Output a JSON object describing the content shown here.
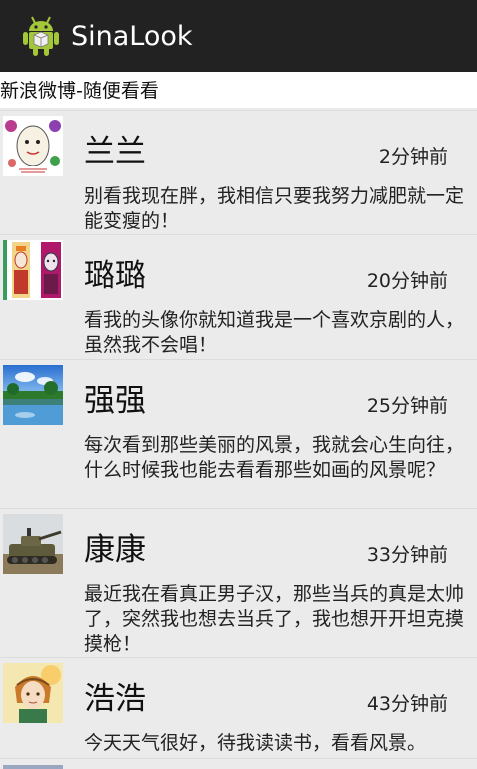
{
  "app": {
    "title": "SinaLook",
    "icon": "android-robot-icon"
  },
  "subtitle": "新浪微博-随便看看",
  "posts": [
    {
      "name": "兰兰",
      "time": "2分钟前",
      "text": "别看我现在胖，我相信只要我努力减肥就一定能变瘦的！",
      "avatar": "cartoon-egg-avatar"
    },
    {
      "name": "璐璐",
      "time": "20分钟前",
      "text": "看我的头像你就知道我是一个喜欢京剧的人，虽然我不会唱！",
      "avatar": "peking-opera-avatar"
    },
    {
      "name": "强强",
      "time": "25分钟前",
      "text": "每次看到那些美丽的风景，我就会心生向往，什么时候我也能去看看那些如画的风景呢？",
      "avatar": "landscape-avatar"
    },
    {
      "name": "康康",
      "time": "33分钟前",
      "text": "最近我在看真正男子汉，那些当兵的真是太帅了，突然我也想去当兵了，我也想开开坦克摸摸枪！",
      "avatar": "tank-avatar"
    },
    {
      "name": "浩浩",
      "time": "43分钟前",
      "text": "今天天气很好，待我读读书，看看风景。",
      "avatar": "anime-character-avatar"
    }
  ]
}
